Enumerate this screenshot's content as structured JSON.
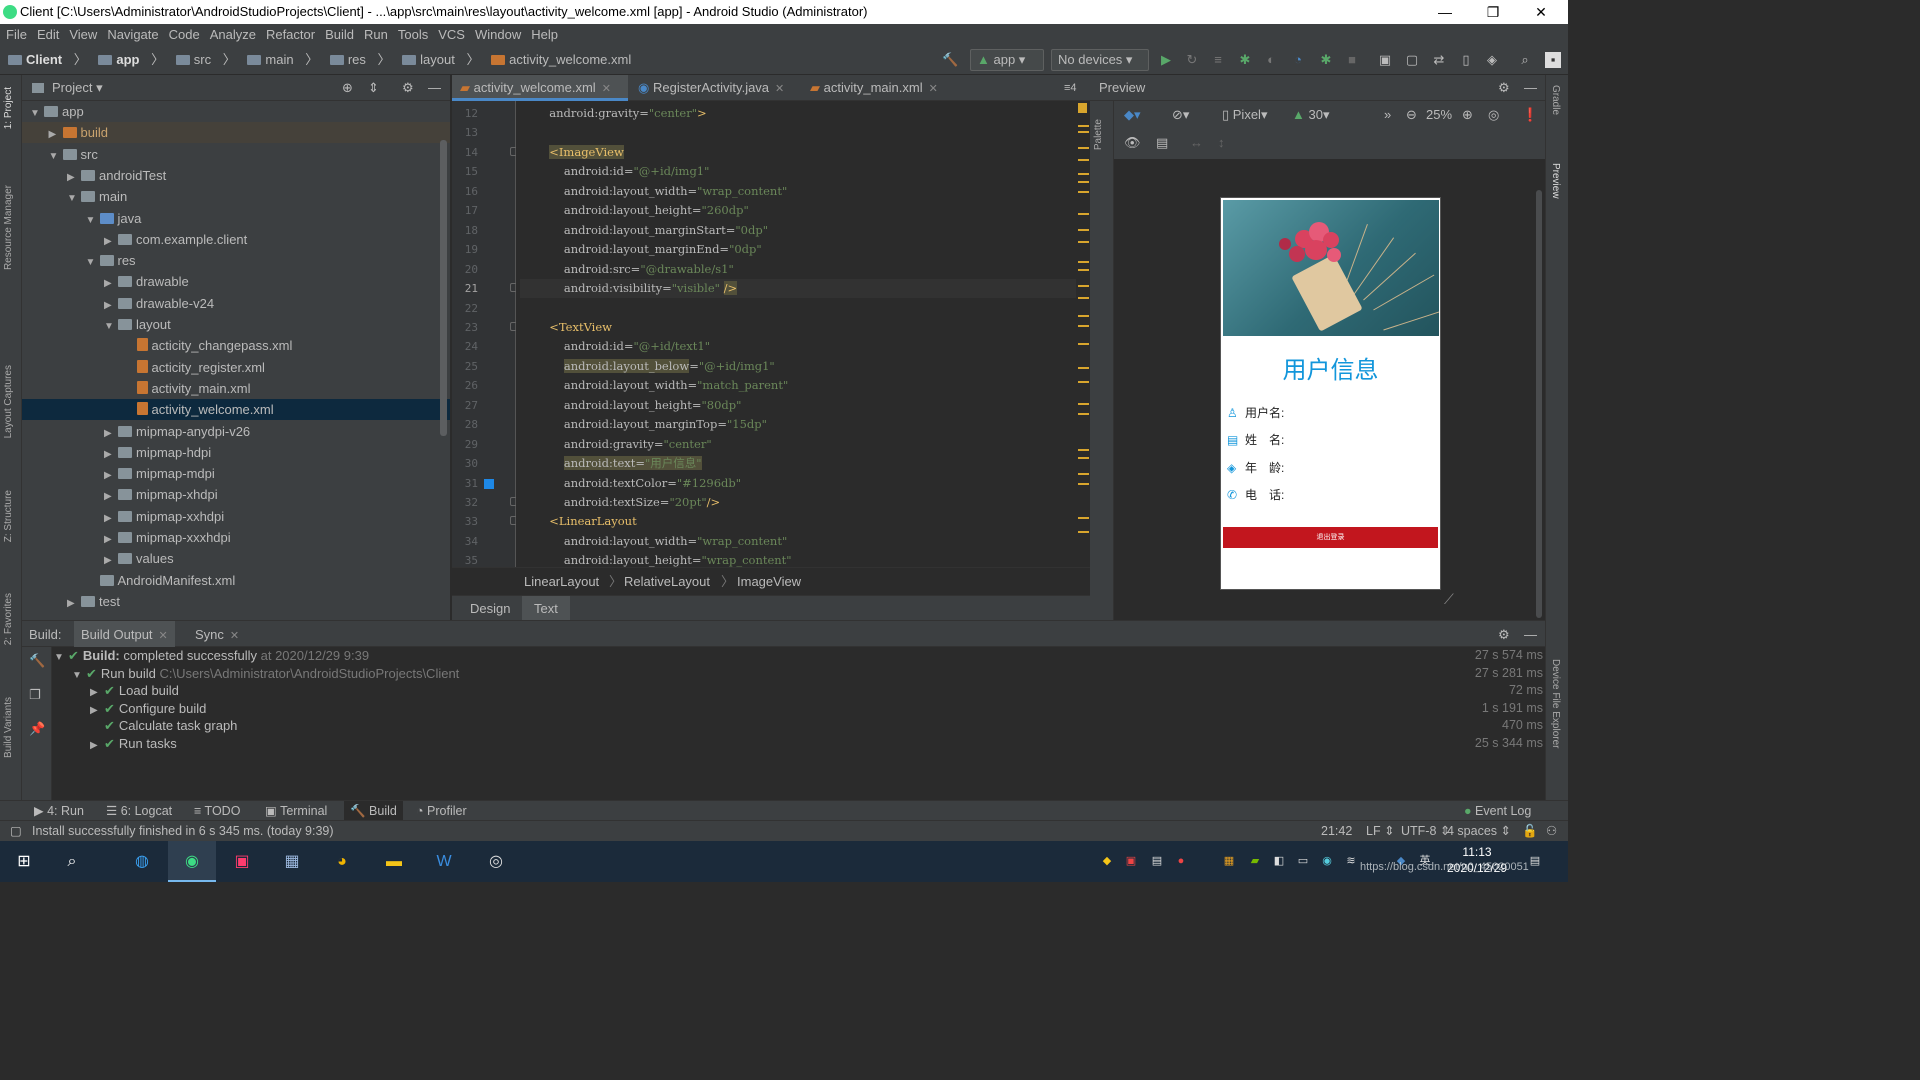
{
  "window": {
    "title": "Client [C:\\Users\\Administrator\\AndroidStudioProjects\\Client] - ...\\app\\src\\main\\res\\layout\\activity_welcome.xml [app] - Android Studio (Administrator)",
    "minimize": "—",
    "restore": "❐",
    "close": "✕"
  },
  "menu": [
    "File",
    "Edit",
    "View",
    "Navigate",
    "Code",
    "Analyze",
    "Refactor",
    "Build",
    "Run",
    "Tools",
    "VCS",
    "Window",
    "Help"
  ],
  "nav": {
    "crumbs": [
      "Client",
      "app",
      "src",
      "main",
      "res",
      "layout",
      "activity_welcome.xml"
    ],
    "run_config": "app",
    "devices": "No devices"
  },
  "left_strip": {
    "project": "1: Project",
    "resource_manager": "Resource Manager",
    "layout_captures": "Layout Captures",
    "structure": "Z: Structure",
    "favorites": "2: Favorites",
    "build_variants": "Build Variants"
  },
  "right_strip": {
    "gradle": "Gradle",
    "preview": "Preview",
    "device_explorer": "Device File Explorer"
  },
  "project_panel": {
    "title": "Project",
    "tree": [
      {
        "label": "app",
        "depth": 0,
        "arrow": "▼",
        "icon": "folder"
      },
      {
        "label": "build",
        "depth": 1,
        "arrow": "▶",
        "icon": "orange"
      },
      {
        "label": "src",
        "depth": 1,
        "arrow": "▼",
        "icon": "folder"
      },
      {
        "label": "androidTest",
        "depth": 2,
        "arrow": "▶",
        "icon": "folder"
      },
      {
        "label": "main",
        "depth": 2,
        "arrow": "▼",
        "icon": "folder"
      },
      {
        "label": "java",
        "depth": 3,
        "arrow": "▼",
        "icon": "blue"
      },
      {
        "label": "com.example.client",
        "depth": 4,
        "arrow": "▶",
        "icon": "folder"
      },
      {
        "label": "res",
        "depth": 3,
        "arrow": "▼",
        "icon": "folder"
      },
      {
        "label": "drawable",
        "depth": 4,
        "arrow": "▶",
        "icon": "folder"
      },
      {
        "label": "drawable-v24",
        "depth": 4,
        "arrow": "▶",
        "icon": "folder"
      },
      {
        "label": "layout",
        "depth": 4,
        "arrow": "▼",
        "icon": "folder"
      },
      {
        "label": "acticity_changepass.xml",
        "depth": 5,
        "arrow": "",
        "icon": "xml"
      },
      {
        "label": "acticity_register.xml",
        "depth": 5,
        "arrow": "",
        "icon": "xml"
      },
      {
        "label": "activity_main.xml",
        "depth": 5,
        "arrow": "",
        "icon": "xml"
      },
      {
        "label": "activity_welcome.xml",
        "depth": 5,
        "arrow": "",
        "icon": "xml"
      },
      {
        "label": "mipmap-anydpi-v26",
        "depth": 4,
        "arrow": "▶",
        "icon": "folder"
      },
      {
        "label": "mipmap-hdpi",
        "depth": 4,
        "arrow": "▶",
        "icon": "folder"
      },
      {
        "label": "mipmap-mdpi",
        "depth": 4,
        "arrow": "▶",
        "icon": "folder"
      },
      {
        "label": "mipmap-xhdpi",
        "depth": 4,
        "arrow": "▶",
        "icon": "folder"
      },
      {
        "label": "mipmap-xxhdpi",
        "depth": 4,
        "arrow": "▶",
        "icon": "folder"
      },
      {
        "label": "mipmap-xxxhdpi",
        "depth": 4,
        "arrow": "▶",
        "icon": "folder"
      },
      {
        "label": "values",
        "depth": 4,
        "arrow": "▶",
        "icon": "folder"
      },
      {
        "label": "AndroidManifest.xml",
        "depth": 3,
        "arrow": "",
        "icon": "folder"
      },
      {
        "label": "test",
        "depth": 2,
        "arrow": "▶",
        "icon": "folder"
      }
    ],
    "selected": "activity_welcome.xml"
  },
  "editor": {
    "tabs": [
      {
        "label": "activity_welcome.xml",
        "active": true
      },
      {
        "label": "RegisterActivity.java",
        "active": false
      },
      {
        "label": "activity_main.xml",
        "active": false
      }
    ],
    "tab_overflow": "≡4",
    "current_line": 21,
    "lines": [
      {
        "n": "12",
        "indent": "        ",
        "parts": [
          [
            "an",
            "android:gravity="
          ],
          [
            "av",
            "\"center\""
          ],
          [
            "tag",
            ">"
          ]
        ]
      },
      {
        "n": "13",
        "indent": "",
        "parts": []
      },
      {
        "n": "14",
        "indent": "        ",
        "parts": [
          [
            "tag hl",
            "<ImageView"
          ]
        ]
      },
      {
        "n": "15",
        "indent": "            ",
        "parts": [
          [
            "an",
            "android:id="
          ],
          [
            "av",
            "\"@+id/img1\""
          ]
        ]
      },
      {
        "n": "16",
        "indent": "            ",
        "parts": [
          [
            "an",
            "android:layout_width="
          ],
          [
            "av",
            "\"wrap_content\""
          ]
        ]
      },
      {
        "n": "17",
        "indent": "            ",
        "parts": [
          [
            "an",
            "android:layout_height="
          ],
          [
            "av",
            "\"260dp\""
          ]
        ]
      },
      {
        "n": "18",
        "indent": "            ",
        "parts": [
          [
            "an",
            "android:layout_marginStart="
          ],
          [
            "av",
            "\"0dp\""
          ]
        ]
      },
      {
        "n": "19",
        "indent": "            ",
        "parts": [
          [
            "an",
            "android:layout_marginEnd="
          ],
          [
            "av",
            "\"0dp\""
          ]
        ]
      },
      {
        "n": "20",
        "indent": "            ",
        "parts": [
          [
            "an",
            "android:src="
          ],
          [
            "av",
            "\"@drawable/s1\""
          ]
        ]
      },
      {
        "n": "21",
        "indent": "            ",
        "parts": [
          [
            "an",
            "android:visibility="
          ],
          [
            "av",
            "\"visible\" "
          ],
          [
            "tag hl",
            "/>"
          ]
        ]
      },
      {
        "n": "22",
        "indent": "",
        "parts": []
      },
      {
        "n": "23",
        "indent": "        ",
        "parts": [
          [
            "tag",
            "<TextView"
          ]
        ]
      },
      {
        "n": "24",
        "indent": "            ",
        "parts": [
          [
            "an",
            "android:id="
          ],
          [
            "av",
            "\"@+id/text1\""
          ]
        ]
      },
      {
        "n": "25",
        "indent": "            ",
        "parts": [
          [
            "an hl",
            "android:layout_below"
          ],
          [
            "an",
            "="
          ],
          [
            "av",
            "\"@+id/img1\""
          ]
        ]
      },
      {
        "n": "26",
        "indent": "            ",
        "parts": [
          [
            "an",
            "android:layout_width="
          ],
          [
            "av",
            "\"match_parent\""
          ]
        ]
      },
      {
        "n": "27",
        "indent": "            ",
        "parts": [
          [
            "an",
            "android:layout_height="
          ],
          [
            "av",
            "\"80dp\""
          ]
        ]
      },
      {
        "n": "28",
        "indent": "            ",
        "parts": [
          [
            "an",
            "android:layout_marginTop="
          ],
          [
            "av",
            "\"15dp\""
          ]
        ]
      },
      {
        "n": "29",
        "indent": "            ",
        "parts": [
          [
            "an",
            "android:gravity="
          ],
          [
            "av",
            "\"center\""
          ]
        ]
      },
      {
        "n": "30",
        "indent": "            ",
        "parts": [
          [
            "an hl",
            "android:text="
          ],
          [
            "av hl",
            "\"用户信息\""
          ]
        ]
      },
      {
        "n": "31",
        "indent": "            ",
        "parts": [
          [
            "an",
            "android:textColor="
          ],
          [
            "av",
            "\"#1296db\""
          ]
        ]
      },
      {
        "n": "32",
        "indent": "            ",
        "parts": [
          [
            "an",
            "android:textSize="
          ],
          [
            "av",
            "\"20pt\""
          ],
          [
            "tag",
            "/>"
          ]
        ]
      },
      {
        "n": "33",
        "indent": "        ",
        "parts": [
          [
            "tag",
            "<LinearLayout"
          ]
        ]
      },
      {
        "n": "34",
        "indent": "            ",
        "parts": [
          [
            "an",
            "android:layout_width="
          ],
          [
            "av",
            "\"wrap_content\""
          ]
        ]
      },
      {
        "n": "35",
        "indent": "            ",
        "parts": [
          [
            "an",
            "android:layout_height="
          ],
          [
            "av",
            "\"wrap_content\""
          ]
        ]
      }
    ],
    "breadcrumb": [
      "LinearLayout",
      "RelativeLayout",
      "ImageView"
    ],
    "design_tabs": [
      "Design",
      "Text"
    ]
  },
  "preview": {
    "title": "Preview",
    "device": "Pixel",
    "api": "30",
    "zoom": "25%",
    "palette": "Palette",
    "phone": {
      "title": "用户信息",
      "title_color": "#1296db",
      "rows": [
        {
          "icon": "person-icon",
          "glyph": "♙",
          "label": "用户名:"
        },
        {
          "icon": "card-icon",
          "glyph": "▤",
          "label": "姓　名:"
        },
        {
          "icon": "tag-icon",
          "glyph": "◈",
          "label": "年　龄:"
        },
        {
          "icon": "phone-icon",
          "glyph": "✆",
          "label": "电　话:"
        }
      ],
      "logout_label": "退出登录",
      "logout_color": "#c2161e"
    }
  },
  "build": {
    "label": "Build:",
    "tabs": [
      "Build Output",
      "Sync"
    ],
    "rows": [
      {
        "indent": 0,
        "arrow": "▼",
        "bold": "Build:",
        "text": " completed successfully",
        "dim": " at 2020/12/29 9:39",
        "time": "27 s 574 ms"
      },
      {
        "indent": 1,
        "arrow": "▼",
        "bold": "",
        "text": "Run build",
        "dim": " C:\\Users\\Administrator\\AndroidStudioProjects\\Client",
        "time": "27 s 281 ms"
      },
      {
        "indent": 2,
        "arrow": "▶",
        "bold": "",
        "text": "Load build",
        "dim": "",
        "time": "72 ms"
      },
      {
        "indent": 2,
        "arrow": "▶",
        "bold": "",
        "text": "Configure build",
        "dim": "",
        "time": "1 s 191 ms"
      },
      {
        "indent": 2,
        "arrow": "",
        "bold": "",
        "text": "Calculate task graph",
        "dim": "",
        "time": "470 ms"
      },
      {
        "indent": 2,
        "arrow": "▶",
        "bold": "",
        "text": "Run tasks",
        "dim": "",
        "time": "25 s 344 ms"
      }
    ]
  },
  "tool_windows": [
    "4: Run",
    "6: Logcat",
    "TODO",
    "Terminal",
    "Build",
    "Profiler"
  ],
  "active_tool_window": "Build",
  "event_log": "Event Log",
  "status": {
    "message": "Install successfully finished in 6 s 345 ms. (today 9:39)",
    "position": "21:42",
    "line_sep": "LF",
    "encoding": "UTF-8",
    "indent": "4 spaces"
  },
  "taskbar": {
    "time": "11:13",
    "date": "2020/12/29",
    "ime": "英",
    "watermark": "https://blog.csdn.net/u0_45020051"
  }
}
